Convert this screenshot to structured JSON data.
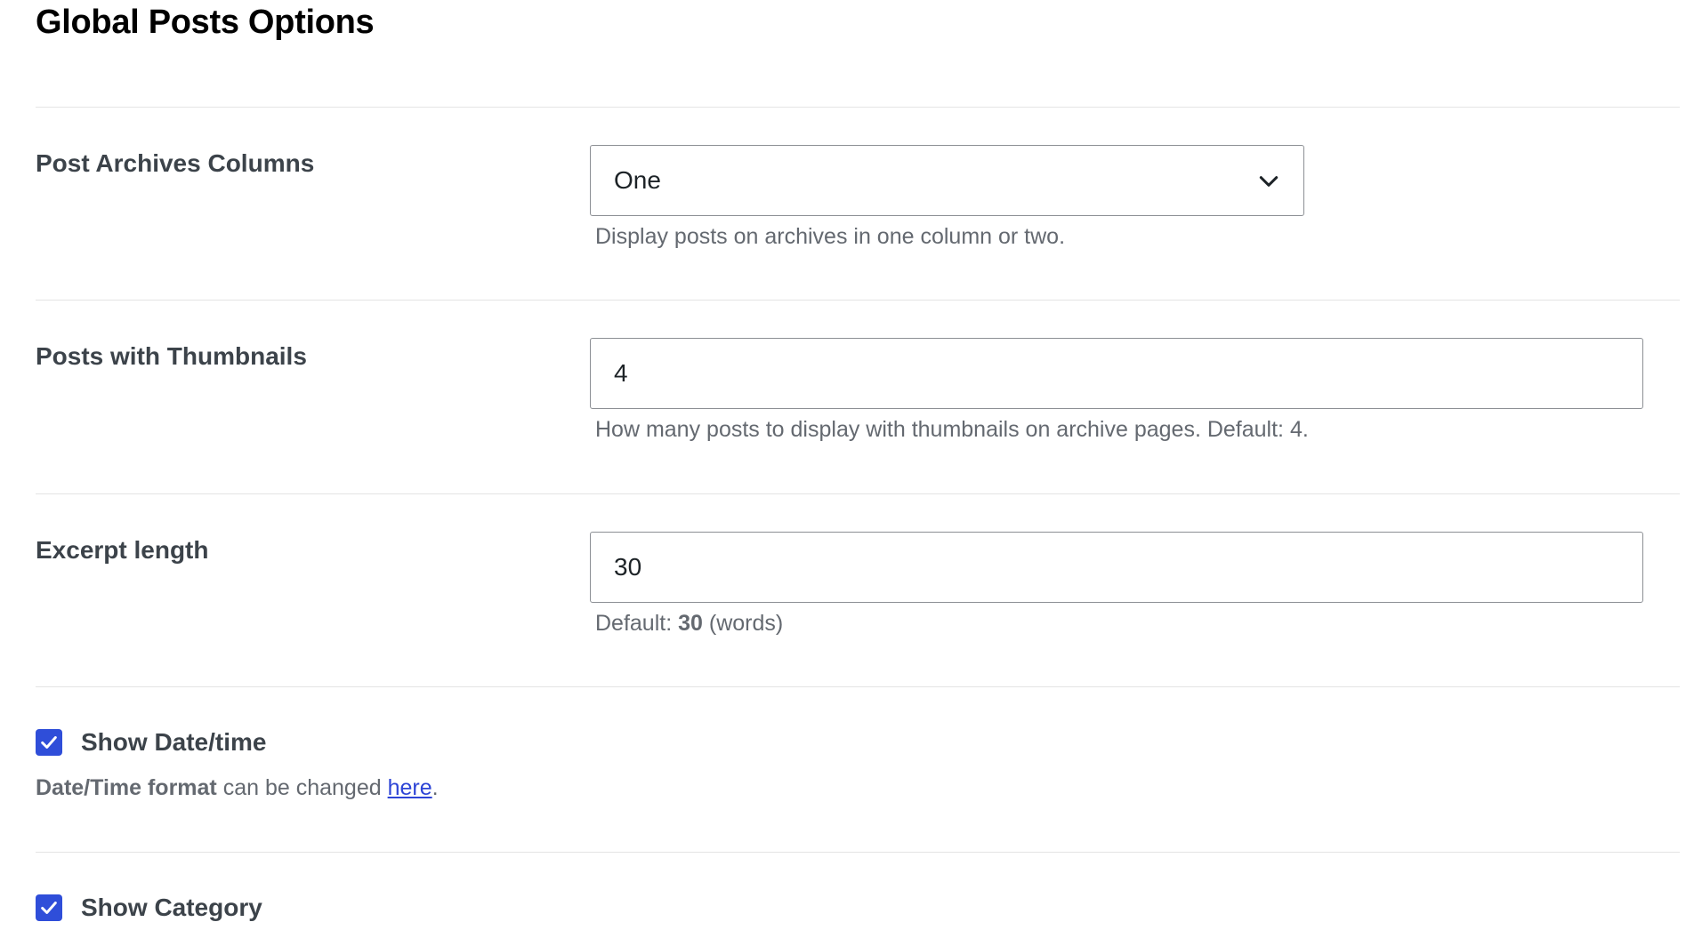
{
  "page": {
    "title": "Global Posts Options"
  },
  "fields": {
    "archive_columns": {
      "label": "Post Archives Columns",
      "selected": "One",
      "help": "Display posts on archives in one column or two."
    },
    "thumbnails": {
      "label": "Posts with Thumbnails",
      "value": "4",
      "help": "How many posts to display with thumbnails on archive pages. Default: 4."
    },
    "excerpt": {
      "label": "Excerpt length",
      "value": "30",
      "help_prefix": "Default:",
      "help_value": "30",
      "help_suffix": "(words)"
    }
  },
  "checkboxes": {
    "show_datetime": {
      "label": "Show Date/time",
      "checked": true,
      "note_bold": "Date/Time format",
      "note_text": "can be changed",
      "note_link": "here",
      "note_end": "."
    },
    "show_category": {
      "label": "Show Category",
      "checked": true
    }
  },
  "icons": {
    "select_arrow": "chevron-down-icon",
    "checkmark": "checkmark-icon"
  },
  "colors": {
    "checkbox_fill": "#2f4ed9",
    "link": "#2d44d6",
    "help_text": "#646970",
    "label_text": "#3c434a"
  }
}
